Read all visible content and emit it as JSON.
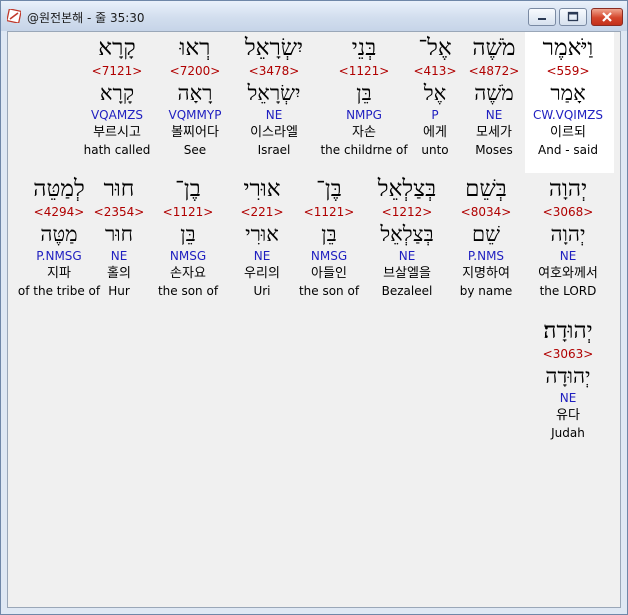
{
  "window": {
    "title": "@원전본해 - 줄 35:30"
  },
  "rows": [
    [
      {
        "hebrew": "וַיֹּאמֶר",
        "strong": "<559>",
        "lemma": "אָמַר",
        "parse": "CW.VQIMZS",
        "korean": "이르되",
        "english": "And - said"
      },
      {
        "hebrew": "מֹשֶׁה",
        "strong": "<4872>",
        "lemma": "מֹשֶׁה",
        "parse": "NE",
        "korean": "모세가",
        "english": "Moses"
      },
      {
        "hebrew": "אֶל־",
        "strong": "<413>",
        "lemma": "אֶל",
        "parse": "P",
        "korean": "에게",
        "english": "unto"
      },
      {
        "hebrew": "בְּנֵי",
        "strong": "<1121>",
        "lemma": "בֵּן",
        "parse": "NMPG",
        "korean": "자손",
        "english": "the childrne of"
      },
      {
        "hebrew": "יִשְׂרָאֵל",
        "strong": "<3478>",
        "lemma": "יִשְׂרָאֵל",
        "parse": "NE",
        "korean": "이스라엘",
        "english": "Israel"
      },
      {
        "hebrew": "רְאוּ",
        "strong": "<7200>",
        "lemma": "רָאָה",
        "parse": "VQMMYP",
        "korean": "볼찌어다",
        "english": "See"
      },
      {
        "hebrew": "קָרָא",
        "strong": "<7121>",
        "lemma": "קָרָא",
        "parse": "VQAMZS",
        "korean": "부르시고",
        "english": "hath called"
      }
    ],
    [
      {
        "hebrew": "יְהוָה",
        "strong": "<3068>",
        "lemma": "יְהוָה",
        "parse": "NE",
        "korean": "여호와께서",
        "english": "the LORD"
      },
      {
        "hebrew": "בְּשֵׁם",
        "strong": "<8034>",
        "lemma": "שֵׁם",
        "parse": "P.NMS",
        "korean": "지명하여",
        "english": "by name"
      },
      {
        "hebrew": "בְּצַלְאֵל",
        "strong": "<1212>",
        "lemma": "בְּצַלְאֵל",
        "parse": "NE",
        "korean": "브살엘을",
        "english": "Bezaleel"
      },
      {
        "hebrew": "בֶּן־",
        "strong": "<1121>",
        "lemma": "בֵּן",
        "parse": "NMSG",
        "korean": "아들인",
        "english": "the son of"
      },
      {
        "hebrew": "אוּרִי",
        "strong": "<221>",
        "lemma": "אוּרִי",
        "parse": "NE",
        "korean": "우리의",
        "english": "Uri"
      },
      {
        "hebrew": "בֶן־",
        "strong": "<1121>",
        "lemma": "בֵּן",
        "parse": "NMSG",
        "korean": "손자요",
        "english": "the son of"
      },
      {
        "hebrew": "חוּר",
        "strong": "<2354>",
        "lemma": "חוּר",
        "parse": "NE",
        "korean": "홀의",
        "english": "Hur"
      },
      {
        "hebrew": "לְמַטֵּה",
        "strong": "<4294>",
        "lemma": "מַטֶּה",
        "parse": "P.NMSG",
        "korean": "지파",
        "english": "of the tribe of"
      }
    ],
    [
      {
        "hebrew": "יְהוּדָה׃",
        "strong": "<3063>",
        "lemma": "יְהוּדָה",
        "parse": "NE",
        "korean": "유다",
        "english": "Judah"
      }
    ]
  ]
}
